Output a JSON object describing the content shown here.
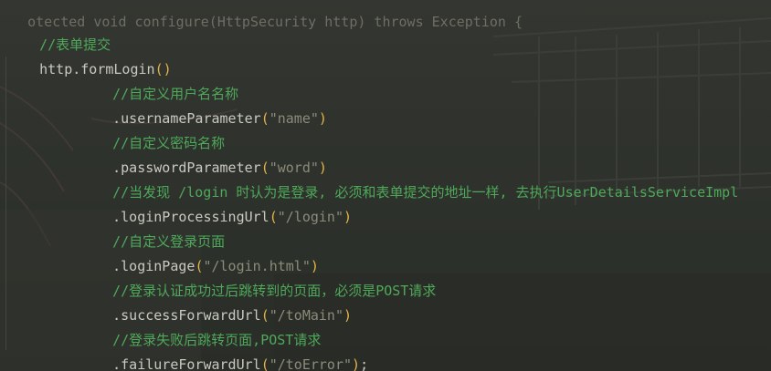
{
  "top_partial_line": "otected void configure(HttpSecurity http) throws Exception {",
  "colors": {
    "comment": "#4fa95a",
    "plain": "#c9c9c0",
    "paren": "#e2b445",
    "string": "#8b8b7a",
    "background": "#2e312c"
  },
  "code": {
    "l1_comment": "//表单提交",
    "l2_obj": "http.formLogin",
    "l2_paren": "()",
    "l3_comment": "//自定义用户名名称",
    "l4_method": ".usernameParameter",
    "l4_arg": "\"name\"",
    "l5_comment": "//自定义密码名称",
    "l6_method": ".passwordParameter",
    "l6_arg": "\"word\"",
    "l7_comment": "//当发现 /login 时认为是登录, 必须和表单提交的地址一样, 去执行UserDetailsServiceImpl",
    "l8_method": ".loginProcessingUrl",
    "l8_arg": "\"/login\"",
    "l9_comment": "//自定义登录页面",
    "l10_method": ".loginPage",
    "l10_arg": "\"/login.html\"",
    "l11_comment": "//登录认证成功过后跳转到的页面，必须是POST请求",
    "l12_method": ".successForwardUrl",
    "l12_arg": "\"/toMain\"",
    "l13_comment": "//登录失败后跳转页面,POST请求",
    "l14_method": ".failureForwardUrl",
    "l14_arg": "\"/toError\"",
    "l14_end": ";"
  },
  "paren_open": "(",
  "paren_close": ")"
}
